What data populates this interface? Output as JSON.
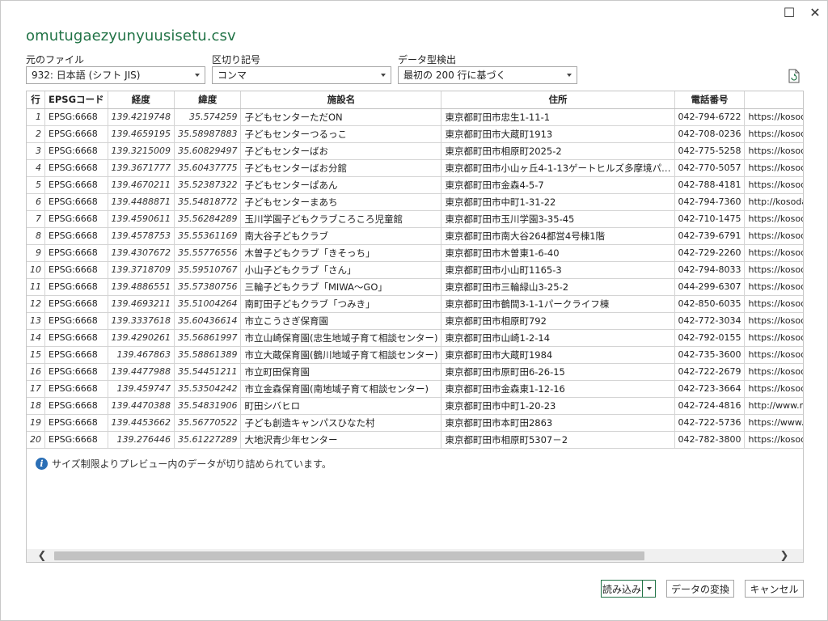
{
  "window": {
    "title": "omutugaezyunyuusisetu.csv",
    "maximize_glyph": "☐",
    "close_glyph": "✕"
  },
  "options": {
    "source_label": "元のファイル",
    "source_value": "932: 日本語 (シフト JIS)",
    "delimiter_label": "区切り記号",
    "delimiter_value": "コンマ",
    "detect_label": "データ型検出",
    "detect_value": "最初の 200 行に基づく"
  },
  "table": {
    "headers": [
      "行",
      "EPSGコード",
      "経度",
      "緯度",
      "施設名",
      "住所",
      "電話番号",
      ""
    ],
    "rows": [
      [
        "1",
        "EPSG:6668",
        "139.4219748",
        "35.574259",
        "子どもセンターただON",
        "東京都町田市忠生1-11-1",
        "042-794-6722",
        "https://kosoda"
      ],
      [
        "2",
        "EPSG:6668",
        "139.4659195",
        "35.58987883",
        "子どもセンターつるっこ",
        "東京都町田市大蔵町1913",
        "042-708-0236",
        "https://kosoda"
      ],
      [
        "3",
        "EPSG:6668",
        "139.3215009",
        "35.60829497",
        "子どもセンターばお",
        "東京都町田市相原町2025-2",
        "042-775-5258",
        "https://kosoda"
      ],
      [
        "4",
        "EPSG:6668",
        "139.3671777",
        "35.60437775",
        "子どもセンターばお分館",
        "東京都町田市小山ヶ丘4-1-13ゲートヒルズ多摩境パ…",
        "042-770-5057",
        "https://kosoda"
      ],
      [
        "5",
        "EPSG:6668",
        "139.4670211",
        "35.52387322",
        "子どもセンターぱあん",
        "東京都町田市金森4-5-7",
        "042-788-4181",
        "https://kosoda"
      ],
      [
        "6",
        "EPSG:6668",
        "139.4488871",
        "35.54818772",
        "子どもセンターまあち",
        "東京都町田市中町1-31-22",
        "042-794-7360",
        "http://kosodat"
      ],
      [
        "7",
        "EPSG:6668",
        "139.4590611",
        "35.56284289",
        "玉川学園子どもクラブころころ児童館",
        "東京都町田市玉川学園3-35-45",
        "042-710-1475",
        "https://kosoda"
      ],
      [
        "8",
        "EPSG:6668",
        "139.4578753",
        "35.55361169",
        "南大谷子どもクラブ",
        "東京都町田市南大谷264都営4号棟1階",
        "042-739-6791",
        "https://kosoda"
      ],
      [
        "9",
        "EPSG:6668",
        "139.4307672",
        "35.55776556",
        "木曽子どもクラブ「きそっち」",
        "東京都町田市木曽東1-6-40",
        "042-729-2260",
        "https://kosoda"
      ],
      [
        "10",
        "EPSG:6668",
        "139.3718709",
        "35.59510767",
        "小山子どもクラブ「さん」",
        "東京都町田市小山町1165-3",
        "042-794-8033",
        "https://kosoda"
      ],
      [
        "11",
        "EPSG:6668",
        "139.4886551",
        "35.57380756",
        "三輪子どもクラブ「MIWA～GO」",
        "東京都町田市三輪緑山3-25-2",
        "044-299-6307",
        "https://kosoda"
      ],
      [
        "12",
        "EPSG:6668",
        "139.4693211",
        "35.51004264",
        "南町田子どもクラブ「つみき」",
        "東京都町田市鶴間3-1-1パークライフ棟",
        "042-850-6035",
        "https://kosoda"
      ],
      [
        "13",
        "EPSG:6668",
        "139.3337618",
        "35.60436614",
        "市立こうさぎ保育園",
        "東京都町田市相原町792",
        "042-772-3034",
        "https://kosoda"
      ],
      [
        "14",
        "EPSG:6668",
        "139.4290261",
        "35.56861997",
        "市立山崎保育園(忠生地域子育て相談センター)",
        "東京都町田市山崎1-2-14",
        "042-792-0155",
        "https://kosoda"
      ],
      [
        "15",
        "EPSG:6668",
        "139.467863",
        "35.58861389",
        "市立大蔵保育園(鶴川地域子育て相談センター)",
        "東京都町田市大蔵町1984",
        "042-735-3600",
        "https://kosoda"
      ],
      [
        "16",
        "EPSG:6668",
        "139.4477988",
        "35.54451211",
        "市立町田保育園",
        "東京都町田市原町田6-26-15",
        "042-722-2679",
        "https://kosoda"
      ],
      [
        "17",
        "EPSG:6668",
        "139.459747",
        "35.53504242",
        "市立金森保育園(南地域子育て相談センター)",
        "東京都町田市金森東1-12-16",
        "042-723-3664",
        "https://kosoda"
      ],
      [
        "18",
        "EPSG:6668",
        "139.4470388",
        "35.54831906",
        "町田シバヒロ",
        "東京都町田市中町1-20-23",
        "042-724-4816",
        "http://www.m"
      ],
      [
        "19",
        "EPSG:6668",
        "139.4453662",
        "35.56770522",
        "子ども創造キャンパスひなた村",
        "東京都町田市本町田2863",
        "042-722-5736",
        "https://www.s"
      ],
      [
        "20",
        "EPSG:6668",
        "139.276446",
        "35.61227289",
        "大地沢青少年センター",
        "東京都町田市相原町5307－2",
        "042-782-3800",
        "https://kosoda"
      ]
    ],
    "notice": "サイズ制限よりプレビュー内のデータが切り詰められています。"
  },
  "scroll": {
    "left_arrow": "❮",
    "right_arrow": "❯"
  },
  "footer": {
    "load_label": "読み込み",
    "transform_label": "データの変換",
    "cancel_label": "キャンセル"
  },
  "colors": {
    "accent": "#217346",
    "info": "#2b6fb6"
  }
}
